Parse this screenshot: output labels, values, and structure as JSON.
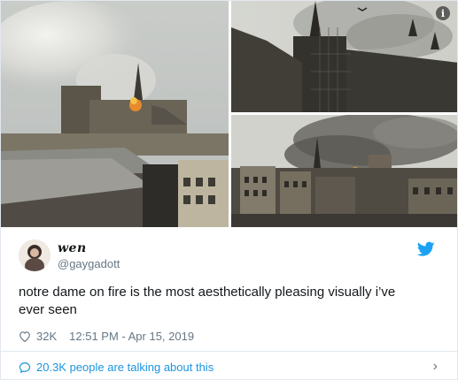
{
  "tweet": {
    "display_name": "wen",
    "handle": "@gaygadott",
    "text_line1": "notre dame on fire is the most aesthetically pleasing visually i’ve",
    "text_line2": "ever seen",
    "likes": "32K",
    "timestamp": "12:51 PM - Apr 15, 2019",
    "talking": "20.3K people are talking about this"
  },
  "icons": {
    "info": "i",
    "chevron": "›"
  },
  "colors": {
    "brand": "#1da1f2",
    "link": "#1b95e0",
    "muted": "#657786"
  }
}
